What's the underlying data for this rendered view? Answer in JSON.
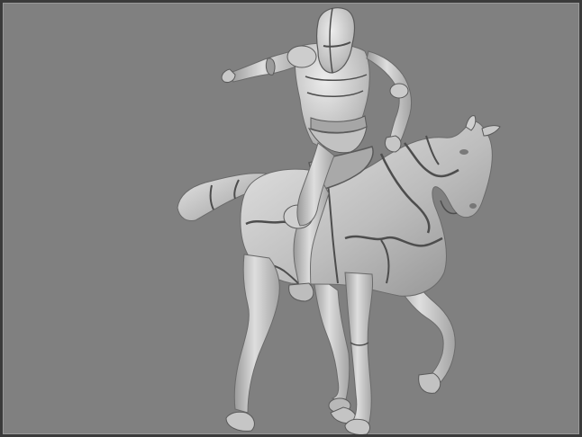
{
  "scene": {
    "subject": "armored-knight-on-horse-3d-render",
    "background_color": "#808080",
    "frame_color": "#3a3a3a",
    "model_color": "#c9c9c9",
    "seam_color": "#4d4d4d"
  }
}
